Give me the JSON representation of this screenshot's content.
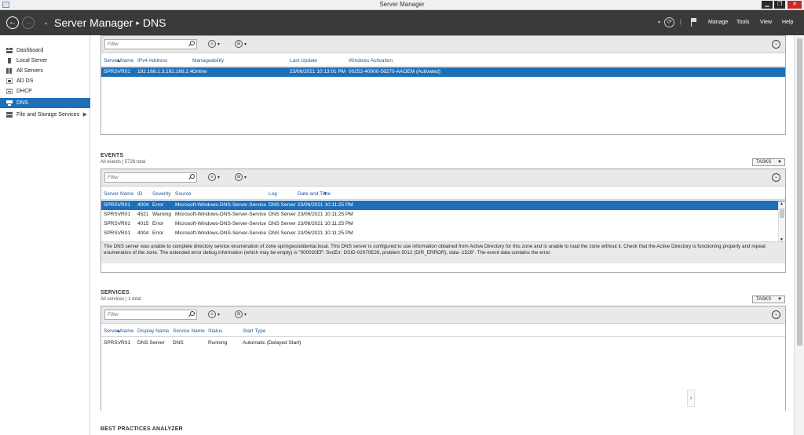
{
  "window": {
    "title": "Server Manager",
    "minimize_label": "▁",
    "restore_label": "❐",
    "close_label": "✕"
  },
  "header": {
    "app_name": "Server Manager",
    "separator": "▸",
    "current_page": "DNS",
    "back_label": "←",
    "forward_label": "→",
    "nav_dropdown": "▾",
    "refresh_dropdown": "▾",
    "refresh_label": "⟳",
    "divider": "|",
    "menu": {
      "manage": "Manage",
      "tools": "Tools",
      "view": "View",
      "help": "Help"
    }
  },
  "sidebar": {
    "items": [
      {
        "label": "Dashboard",
        "icon": "dashboard-icon"
      },
      {
        "label": "Local Server",
        "icon": "server-icon"
      },
      {
        "label": "All Servers",
        "icon": "servers-icon"
      },
      {
        "label": "AD DS",
        "icon": "ad-ds-icon"
      },
      {
        "label": "DHCP",
        "icon": "dhcp-icon"
      },
      {
        "label": "DNS",
        "icon": "dns-icon",
        "active": true
      },
      {
        "label": "File and Storage Services",
        "icon": "storage-icon",
        "caret": "▶"
      }
    ]
  },
  "common": {
    "filter_placeholder": "Filter",
    "expand_symbol": "⌄",
    "dropdown_symbol": "▾",
    "list_symbol": "≡",
    "save_symbol": "⊞",
    "tasks_label": "TASKS",
    "sort_symbol": "▲",
    "scroll_up": "▲",
    "scroll_down": "▼",
    "side_arrow": "›"
  },
  "servers": {
    "columns": [
      "Server Name",
      "IPv4 Address",
      "Manageability",
      "Last Update",
      "Windows Activation"
    ],
    "rows": [
      [
        "SPRSVR01",
        "192.168.1.3,192.168.2.4",
        "Online",
        "23/06/2021 10:13:01 PM",
        "00252-40000-56270-AAOEM (Activated)"
      ]
    ]
  },
  "events": {
    "title": "EVENTS",
    "subtitle": "All events | 5728 total",
    "columns": [
      "Server Name",
      "ID",
      "Severity",
      "Source",
      "Log",
      "Date and Time"
    ],
    "rows": [
      [
        "SPRSVR01",
        "4004",
        "Error",
        "Microsoft-Windows-DNS-Server-Service",
        "DNS Server",
        "23/06/2021 10:11:25 PM"
      ],
      [
        "SPRSVR01",
        "4521",
        "Warning",
        "Microsoft-Windows-DNS-Server-Service",
        "DNS Server",
        "23/06/2021 10:11:25 PM"
      ],
      [
        "SPRSVR01",
        "4015",
        "Error",
        "Microsoft-Windows-DNS-Server-Service",
        "DNS Server",
        "23/06/2021 10:11:25 PM"
      ],
      [
        "SPRSVR01",
        "4004",
        "Error",
        "Microsoft-Windows-DNS-Server-Service",
        "DNS Server",
        "23/06/2021 10:11:25 PM"
      ]
    ],
    "detail": "The DNS server was unable to complete directory service enumeration of zone springwooddental.local.  This DNS server is configured to use information obtained from Active Directory for this zone and is unable to load the zone without it.  Check that the Active Directory is functioning properly and repeat enumeration of the zone. The extended error debug information (which may be empty) is \"000020EF: SvcErr: DSID-02070E26, problem 5012 (DIR_ERROR), data -1526\". The event data contains the error."
  },
  "services": {
    "title": "SERVICES",
    "subtitle": "All services | 1 total",
    "columns": [
      "Server Name",
      "Display Name",
      "Service Name",
      "Status",
      "Start Type"
    ],
    "rows": [
      [
        "SPRSVR01",
        "DNS Server",
        "DNS",
        "Running",
        "Automatic (Delayed Start)"
      ]
    ]
  },
  "bpa": {
    "title": "BEST PRACTICES ANALYZER"
  }
}
